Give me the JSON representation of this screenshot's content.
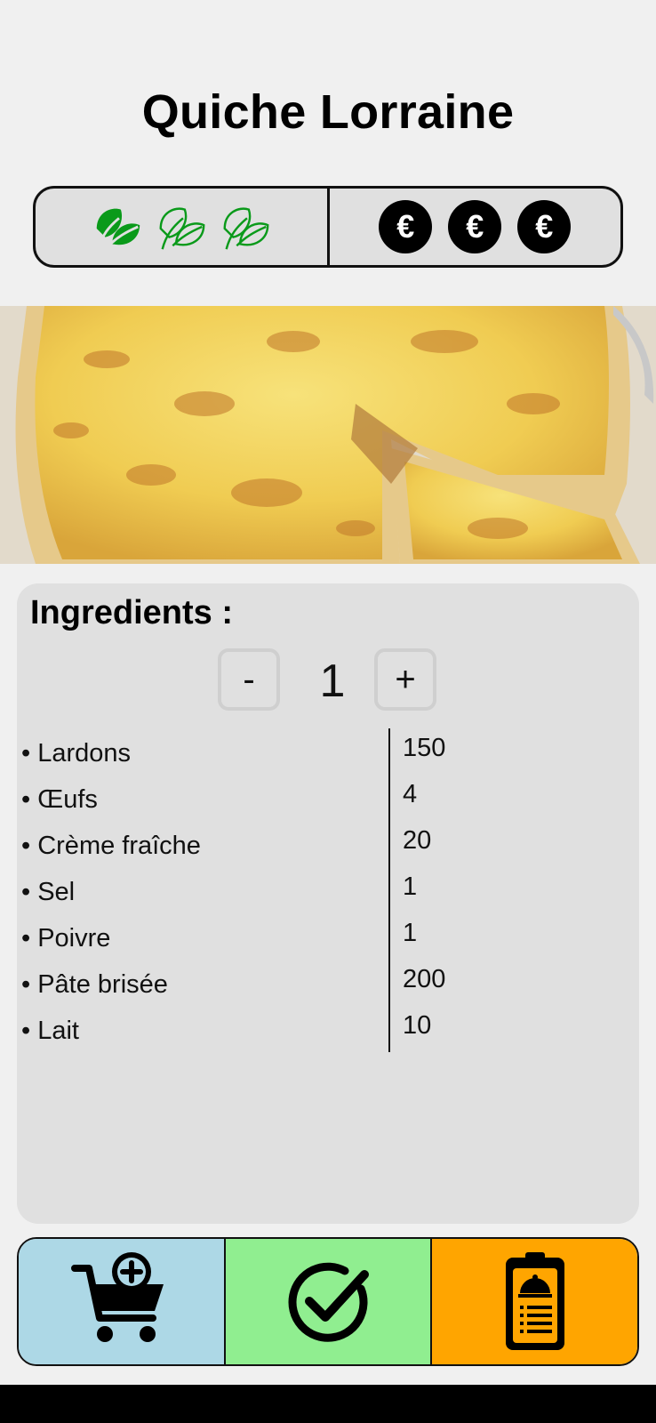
{
  "recipe": {
    "title": "Quiche Lorraine"
  },
  "ratings": {
    "eco": {
      "icon": "leaf-icon",
      "level": 1,
      "max": 3,
      "color": "#0a9a1a"
    },
    "price": {
      "icon": "euro-icon",
      "symbol": "€",
      "level": 3,
      "max": 3
    }
  },
  "ingredients": {
    "heading": "Ingredients :",
    "servings": {
      "minus_label": "-",
      "value": "1",
      "plus_label": "+"
    },
    "items": [
      {
        "name": "• Lardons",
        "qty": "150"
      },
      {
        "name": "• Œufs",
        "qty": "4"
      },
      {
        "name": "• Crème fraîche",
        "qty": "20"
      },
      {
        "name": "• Sel",
        "qty": "1"
      },
      {
        "name": "• Poivre",
        "qty": "1"
      },
      {
        "name": "• Pâte brisée",
        "qty": "200"
      },
      {
        "name": "• Lait",
        "qty": "10"
      }
    ]
  },
  "actions": {
    "cart": {
      "icon": "add-to-cart-icon",
      "color": "#add8e6"
    },
    "check": {
      "icon": "check-circle-icon",
      "color": "#90ee90"
    },
    "menu": {
      "icon": "menu-clipboard-icon",
      "color": "#ffa500"
    }
  }
}
